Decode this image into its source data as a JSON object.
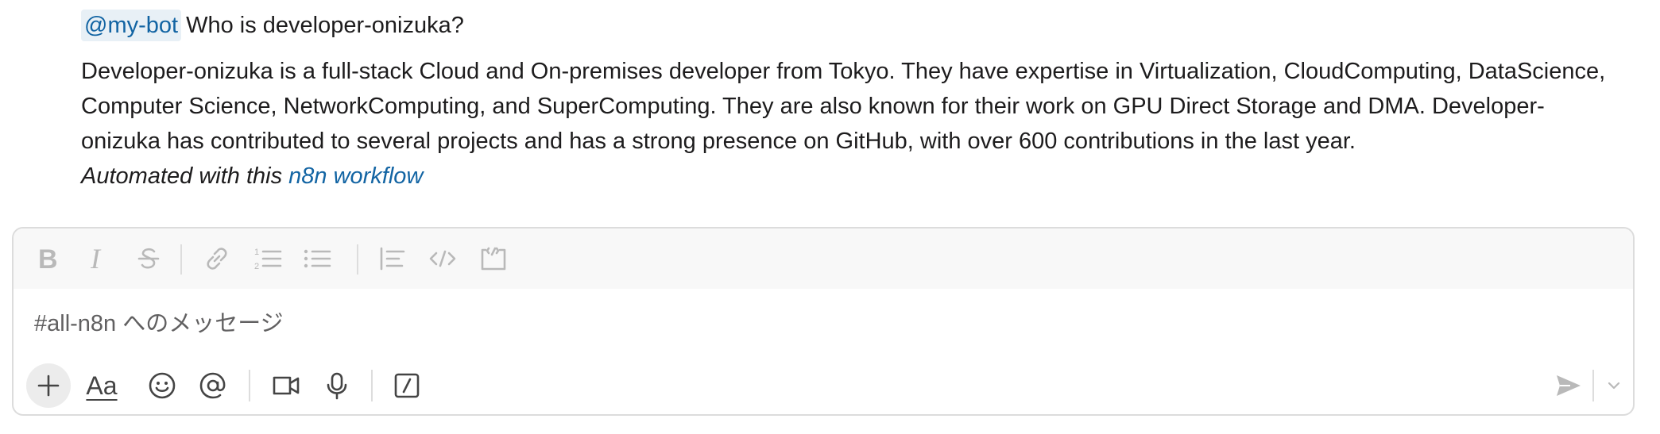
{
  "message": {
    "mention": "@my-bot",
    "query": "Who is developer-onizuka?",
    "reply_lines": [
      "Developer-onizuka is a full-stack Cloud and On-premises developer from Tokyo. They have expertise in Virtualization, CloudComputing, DataScience,",
      "Computer Science, NetworkComputing, and SuperComputing. They are also known for their work on GPU Direct Storage and DMA. Developer-",
      "onizuka has contributed to several projects and has a strong presence on GitHub, with over 600 contributions in the last year."
    ],
    "automated_prefix": "Automated with this",
    "automated_link": "n8n workflow"
  },
  "composer": {
    "placeholder": "#all-n8n へのメッセージ",
    "format_toolbar": [
      "bold-icon",
      "italic-icon",
      "strikethrough-icon",
      "link-icon",
      "numbered-list-icon",
      "bulleted-list-icon",
      "blockquote-icon",
      "code-icon",
      "code-block-icon"
    ],
    "action_toolbar": [
      "plus-icon",
      "text-format-icon",
      "emoji-icon",
      "mention-icon",
      "video-icon",
      "microphone-icon",
      "slash-command-icon",
      "send-icon",
      "chevron-down-icon"
    ],
    "text_format_label": "Aa"
  },
  "colors": {
    "link": "#1264a3",
    "mention_bg": "#e8f0f6",
    "toolbar_bg": "#f8f8f8",
    "disabled_icon": "#b9b9b9"
  }
}
